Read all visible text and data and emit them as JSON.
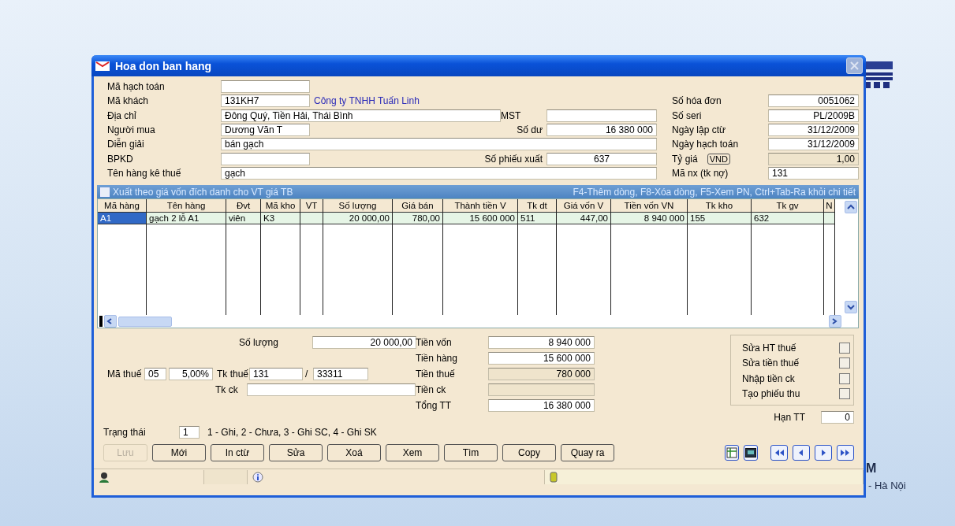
{
  "window": {
    "title": "Hoa don ban hang"
  },
  "form_left": [
    {
      "items": [
        {
          "kind": "label",
          "text": "Mã hạch toán"
        },
        {
          "kind": "field"
        }
      ]
    },
    {
      "items": [
        {
          "kind": "label",
          "text": "Mã khách"
        },
        {
          "kind": "field",
          "value": "131KH7"
        },
        {
          "kind": "link",
          "text": "Công ty TNHH Tuấn Linh"
        }
      ]
    },
    {
      "items": [
        {
          "kind": "label",
          "text": "Địa chỉ"
        },
        {
          "kind": "field",
          "value": "Đông Quý, Tiền Hải, Thái Bình"
        },
        {
          "kind": "label",
          "text": "MST"
        },
        {
          "kind": "field"
        }
      ]
    },
    {
      "items": [
        {
          "kind": "label",
          "text": "Người mua"
        },
        {
          "kind": "field",
          "value": "Dương Văn T"
        },
        {
          "kind": "rlabel",
          "text": "Số dư"
        },
        {
          "kind": "field",
          "value": "16 380 000"
        }
      ]
    },
    {
      "items": [
        {
          "kind": "label",
          "text": "Diễn giải"
        },
        {
          "kind": "field",
          "value": "bán gạch"
        }
      ]
    },
    {
      "items": [
        {
          "kind": "label",
          "text": "BPKD"
        },
        {
          "kind": "field"
        },
        {
          "kind": "rlabel",
          "text": "Số phiếu xuất"
        },
        {
          "kind": "field",
          "value": "637"
        }
      ]
    },
    {
      "items": [
        {
          "kind": "label",
          "text": "Tên hàng kê thuế"
        },
        {
          "kind": "field",
          "value": "gạch"
        }
      ]
    }
  ],
  "form_right": [
    {
      "label": "Số hóa đơn",
      "value": "0051062",
      "disabled": false
    },
    {
      "label": "Số seri",
      "value": "PL/2009B",
      "disabled": false
    },
    {
      "label": "Ngày lập ctừ",
      "value": "31/12/2009",
      "disabled": false
    },
    {
      "label": "Ngày hạch toán",
      "value": "31/12/2009",
      "disabled": false
    },
    {
      "label": "Tỷ giá",
      "badge": "VND",
      "value": "1,00",
      "disabled": true
    },
    {
      "label": "Mã nx (tk nợ)",
      "value": "131",
      "disabled": false
    }
  ],
  "detail_bar": {
    "checkbox_label": "Xuất theo giá vốn đích danh cho VT giá TB",
    "checked": false,
    "hint": "F4-Thêm dòng, F8-Xóa dòng, F5-Xem PN, Ctrl+Tab-Ra khỏi chi tiết"
  },
  "table": {
    "columns": [
      "Mã hàng",
      "Tên hàng",
      "Đvt",
      "Mã kho",
      "VT",
      "Số lượng",
      "Giá bán",
      "Thành tiền V",
      "Tk dt",
      "Giá vốn V",
      "Tiền vốn VN",
      "Tk kho",
      "Tk gv",
      "N"
    ],
    "rows": [
      {
        "selected": true,
        "cells": [
          "A1",
          "gạch 2 lỗ A1",
          "viên",
          "K3",
          "",
          "20 000,00",
          "780,00",
          "15 600 000",
          "511",
          "447,00",
          "8 940 000",
          "155",
          "632",
          ""
        ]
      }
    ]
  },
  "totals": {
    "quantity": {
      "label": "Số lượng",
      "value": "20 000,00"
    },
    "tax_code": {
      "label": "Mã thuế",
      "code": "05",
      "rate": "5,00%"
    },
    "tax_account": {
      "label": "Tk thuế",
      "debit": "131",
      "separator": "/",
      "credit": "33311"
    },
    "discount_account": {
      "label": "Tk ck"
    },
    "amounts": [
      {
        "label": "Tiền vốn",
        "value": "8 940 000",
        "disabled": false
      },
      {
        "label": "Tiền hàng",
        "value": "15 600 000",
        "disabled": false
      },
      {
        "label": "Tiền thuế",
        "value": "780 000",
        "disabled": true
      },
      {
        "label": "Tiền ck",
        "disabled": true
      },
      {
        "label": "Tổng TT",
        "value": "16 380 000",
        "disabled": false
      }
    ],
    "options": [
      {
        "label": "Sửa HT thuế",
        "checked": false
      },
      {
        "label": "Sửa tiền thuế",
        "checked": false
      },
      {
        "label": "Nhập tiền ck",
        "checked": false
      },
      {
        "label": "Tạo phiếu thu",
        "checked": false
      }
    ],
    "due": {
      "label": "Hạn TT",
      "value": "0"
    },
    "status": {
      "label": "Trạng thái",
      "value": "1",
      "legend": "1 - Ghi, 2 - Chưa, 3 - Ghi SC, 4 - Ghi SK"
    }
  },
  "buttons": [
    {
      "label": "Lưu",
      "disabled": true
    },
    {
      "label": "Mới",
      "disabled": false
    },
    {
      "label": "In ctừ",
      "disabled": false
    },
    {
      "label": "Sửa",
      "disabled": false
    },
    {
      "label": "Xoá",
      "disabled": false
    },
    {
      "label": "Xem",
      "disabled": false
    },
    {
      "label": "Tìm",
      "disabled": false
    },
    {
      "label": "Copy",
      "disabled": false
    },
    {
      "label": "Quay ra",
      "disabled": false
    }
  ],
  "background": {
    "letter": "M",
    "city": "- Hà Nội"
  }
}
